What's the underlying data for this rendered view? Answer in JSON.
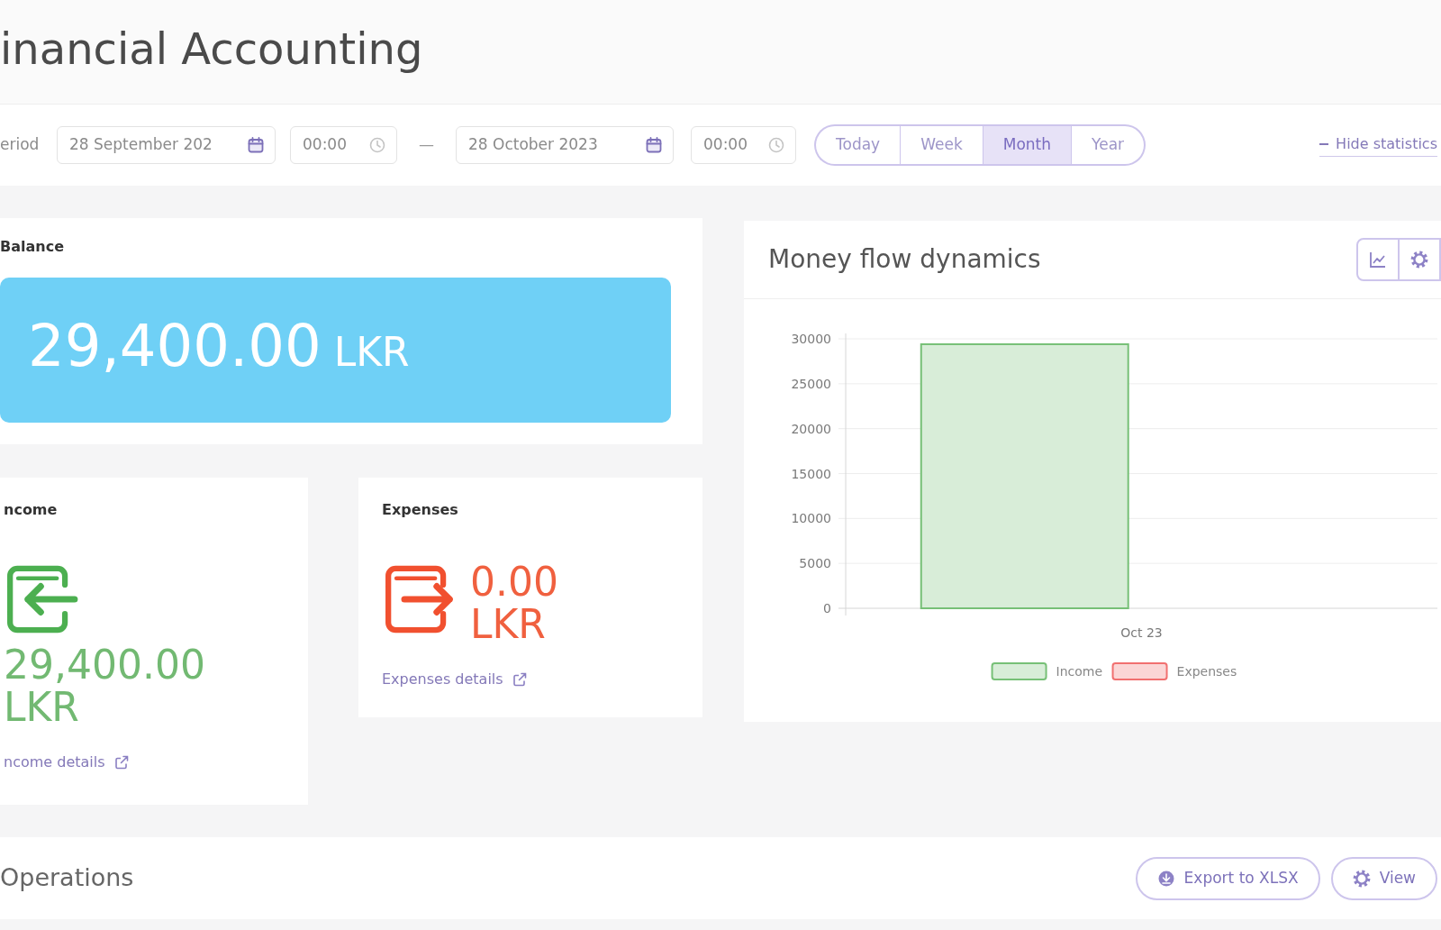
{
  "header": {
    "title": "inancial Accounting"
  },
  "toolbar": {
    "period_label": "eriod",
    "date_from": "28 September 202",
    "time_from": "00:00",
    "separator": "—",
    "date_to": "28 October 2023",
    "time_to": "00:00",
    "ranges": [
      {
        "label": "Today",
        "selected": false
      },
      {
        "label": "Week",
        "selected": false
      },
      {
        "label": "Month",
        "selected": true
      },
      {
        "label": "Year",
        "selected": false
      }
    ],
    "toggle_link": "Hide statistics"
  },
  "balance": {
    "title": "Balance",
    "amount": "29,400.00",
    "currency": "LKR"
  },
  "income": {
    "title": "ncome",
    "amount": "29,400.00",
    "currency": "LKR",
    "link": "ncome details"
  },
  "expenses": {
    "title": "Expenses",
    "amount": "0.00",
    "currency": "LKR",
    "link": "Expenses details"
  },
  "chart_panel": {
    "title": "Money flow dynamics",
    "chart_data": {
      "type": "bar",
      "categories": [
        "Oct 23"
      ],
      "series": [
        {
          "name": "Income",
          "color": "#d8edd8",
          "values": [
            29400
          ]
        },
        {
          "name": "Expenses",
          "color": "#fbd6d6",
          "values": [
            0
          ]
        }
      ],
      "ylim": [
        0,
        30000
      ],
      "yticks": [
        0,
        5000,
        10000,
        15000,
        20000,
        25000,
        30000
      ],
      "grid": true,
      "legend": "bottom"
    }
  },
  "operations": {
    "title": "Operations",
    "buttons": [
      {
        "kind": "export",
        "label": "Export to XLSX"
      },
      {
        "kind": "view",
        "label": "View"
      }
    ]
  }
}
